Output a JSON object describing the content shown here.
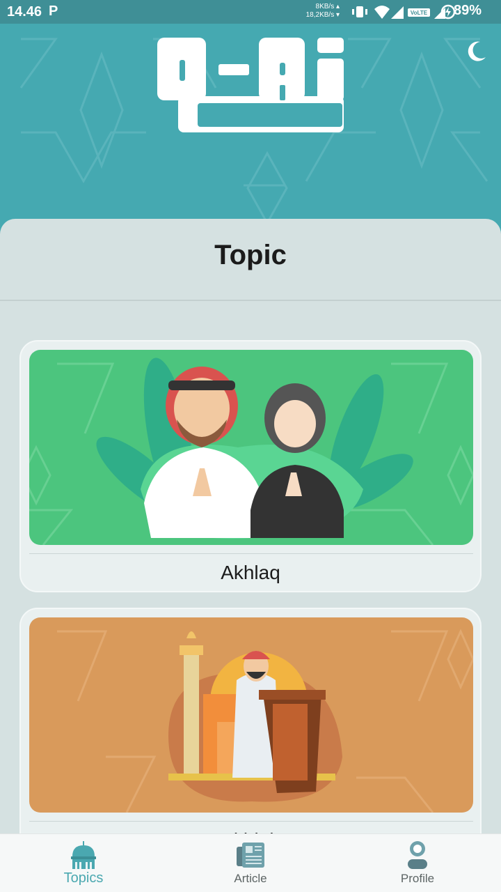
{
  "status_bar": {
    "time": "14.46",
    "p_indicator": "P",
    "speed_up": "8KB/s ▴",
    "speed_down": "18,2KB/s ▾",
    "battery": "89%",
    "volte": "VoLTE"
  },
  "header": {
    "logo_text": "Q-Ai",
    "theme_toggle_icon": "moon-icon"
  },
  "main": {
    "title": "Topic",
    "topics": [
      {
        "label": "Akhlaq",
        "image": "praying-couple-illustration",
        "color": "#4cc57e"
      },
      {
        "label": "Akidah",
        "image": "mosque-preacher-illustration",
        "color": "#d99a5b"
      }
    ]
  },
  "bottom_nav": {
    "items": [
      {
        "label": "Topics",
        "icon": "mosque-icon",
        "active": true
      },
      {
        "label": "Article",
        "icon": "newspaper-icon",
        "active": false
      },
      {
        "label": "Profile",
        "icon": "person-icon",
        "active": false
      }
    ]
  },
  "colors": {
    "header_bg": "#45a9b1",
    "status_bar_bg": "#3f8f96",
    "panel_bg": "#d5e1e1",
    "accent": "#4aa8b0"
  }
}
